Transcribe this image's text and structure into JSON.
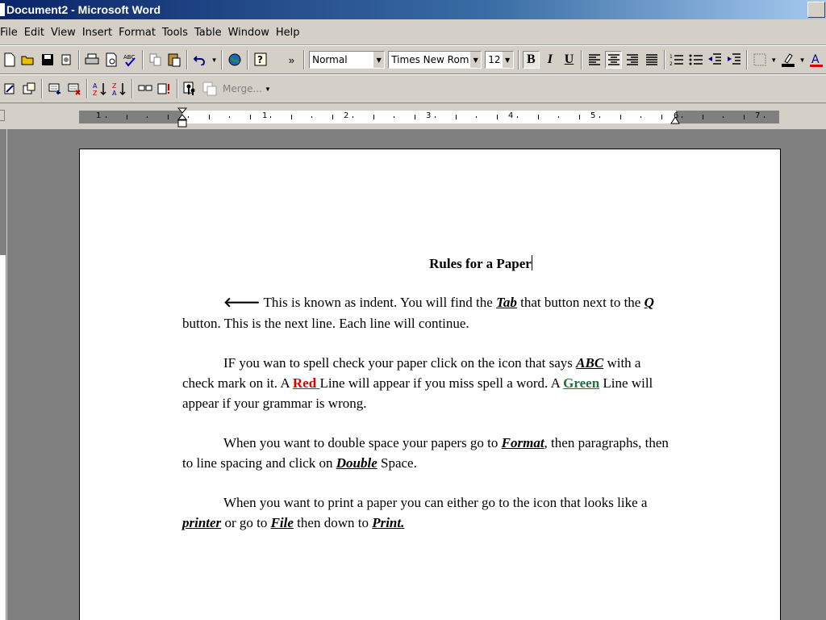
{
  "window": {
    "title": "Document2 - Microsoft Word"
  },
  "menu": {
    "items": [
      "File",
      "Edit",
      "View",
      "Insert",
      "Format",
      "Tools",
      "Table",
      "Window",
      "Help"
    ]
  },
  "formatting": {
    "style": "Normal",
    "font": "Times New Roman",
    "size": "12",
    "bold": "B",
    "italic": "I",
    "underline": "U"
  },
  "toolbar2": {
    "merge_label": "Merge..."
  },
  "ruler": {
    "numbers": [
      "1",
      "1",
      "2",
      "3",
      "4",
      "5",
      "6",
      "7"
    ]
  },
  "document": {
    "title": "Rules for a Paper",
    "p1": {
      "arrow": "🡐",
      "t1": " This is known as indent. You will find the ",
      "k1": "Tab",
      "t2": " that button next to the ",
      "k2": "Q",
      "t3": " button. This is the next line. Each line will continue."
    },
    "p2": {
      "t1": "IF you wan to spell check your paper click on the icon that says ",
      "k1": "ABC",
      "t2": " with a check mark on it.  A ",
      "red": "Red ",
      "t3": "Line will appear if you miss spell a word. A ",
      "green": "Green",
      "t4": " Line will appear if your grammar is wrong."
    },
    "p3": {
      "t1": "When you want to double space your papers go to ",
      "k1": "Format",
      "t2": ", then paragraphs, then to line spacing and click on ",
      "k2": "Double",
      "t3": " Space."
    },
    "p4": {
      "t1": "When you want to print a paper you can either go to the icon that looks like a ",
      "k1": "printer",
      "t2": " or go to ",
      "k2": "File",
      "t3": " then down to ",
      "k3": "Print."
    }
  },
  "colors": {
    "red_line": "#e00000",
    "green_line": "#207040",
    "title_bar": "#0a246a"
  }
}
